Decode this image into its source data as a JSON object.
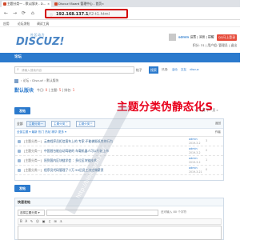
{
  "browser": {
    "tabs": [
      {
        "label": "主题分类一 - 默认版块 - D..."
      },
      {
        "label": "Discuz! Board 管理中心 - 首页"
      },
      {
        "label": "..."
      }
    ],
    "url_host": "192.168.137.1",
    "url_path": "/f2-t1.html",
    "bookmarks": [
      "应用",
      "论坛发帖",
      "调试工具"
    ]
  },
  "header": {
    "logo_cn": "社区动力",
    "logo_text": "DISCUZ!",
    "username": "admin",
    "user_links": "设置 | 消息 | 提醒",
    "qq_button": "QQ马上登录",
    "user_line2": "积分: 31 | 用户组: 管理员 | 退出"
  },
  "nav": {
    "forum": "论坛"
  },
  "search": {
    "placeholder": "请输入搜索内容",
    "scope": "帖子",
    "button": "搜索",
    "hot_label": "热搜:",
    "hot_items": [
      "活动",
      "交友",
      "discuz"
    ]
  },
  "breadcrumb": "› 论坛 › Discuz! › 默认版块",
  "forum": {
    "name": "默认版块",
    "stats_prefix": "今日:",
    "today": "0",
    "topics_label": "| 主题:",
    "topics": "5",
    "rank_label": "| 排名:",
    "rank": "1"
  },
  "overlay_title": "主题分类伪静态化S",
  "toolbar": {
    "post_button": "发帖",
    "pager": "1 / 1 页  下一页 »"
  },
  "filters": {
    "all": "全部",
    "options": [
      "主题分类一",
      "主题分类二",
      "主题分类三"
    ],
    "right": "返回"
  },
  "sort": {
    "left": "全部主题 ▾   最新   热门   热帖   精华   更多 ▾",
    "right": "作者"
  },
  "threads": [
    {
      "category": "[主题分类一]",
      "title": "云南程序员拒信客车上的 专家:不能做贬低性的行为",
      "author": "admin",
      "date": "2019-3-2",
      "count": "3"
    },
    {
      "category": "[主题分类一]",
      "title": "中国首台能自动驾驶的 车载机器人可以行驶上市",
      "author": "admin",
      "date": "2019-3-2",
      "count": "2"
    },
    {
      "category": "[主题分类一]",
      "title": "阳到国内区块链学会 ：多位区块链技术",
      "author": "admin",
      "date": "2019-3-2",
      "count": "1"
    },
    {
      "category": "[主题分类一]",
      "title": "程序员代码管理了十万 90后员工决定做薪资",
      "author": "admin",
      "date": "2019-3-21",
      "count": "0"
    }
  ],
  "quick_post": {
    "header": "快速发帖",
    "category_select": "选择主题分类 ▾",
    "limit": "还可输入 80 个字符",
    "toolbar_icons": "B A ✎ ☺ ▣ ♫ ⊞ ⚓"
  },
  "watermark": "http://blog.csdn.net/"
}
